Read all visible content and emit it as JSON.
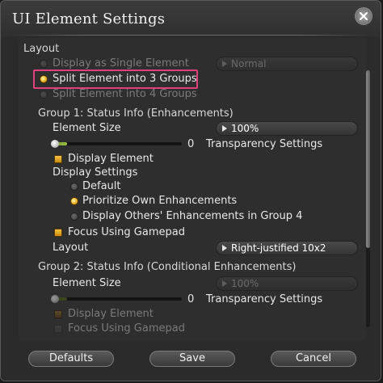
{
  "window": {
    "title": "UI Element Settings"
  },
  "layout": {
    "header": "Layout",
    "options": [
      {
        "label": "Display as Single Element",
        "selected": false
      },
      {
        "label": "Split Element into 3 Groups",
        "selected": true
      },
      {
        "label": "Split Element into 4 Groups",
        "selected": false
      }
    ],
    "single_dropdown_value": "Normal"
  },
  "group1": {
    "header": "Group 1: Status Info (Enhancements)",
    "element_size_label": "Element Size",
    "element_size_value": "100%",
    "transparency_value": "0",
    "transparency_level": 0,
    "transparency_label": "Transparency Settings",
    "display_element_label": "Display Element",
    "display_element_checked": true,
    "display_settings_label": "Display Settings",
    "display_options": [
      {
        "label": "Default",
        "selected": false
      },
      {
        "label": "Prioritize Own Enhancements",
        "selected": true
      },
      {
        "label": "Display Others' Enhancements in Group 4",
        "selected": false
      }
    ],
    "focus_gamepad_label": "Focus Using Gamepad",
    "focus_gamepad_checked": true,
    "layout_label": "Layout",
    "layout_value": "Right-justified 10x2"
  },
  "group2": {
    "header": "Group 2: Status Info (Conditional Enhancements)",
    "element_size_label": "Element Size",
    "element_size_value": "100%",
    "transparency_value": "0",
    "transparency_level": 0,
    "transparency_label": "Transparency Settings",
    "display_element_label": "Display Element",
    "display_element_checked": true,
    "focus_gamepad_label": "Focus Using Gamepad",
    "focus_gamepad_checked": false
  },
  "footer": {
    "defaults_label": "Defaults",
    "save_label": "Save",
    "cancel_label": "Cancel"
  },
  "colors": {
    "highlight_border": "#e0407a",
    "accent_gold": "#e8b020",
    "slider_green": "#9ac040"
  }
}
